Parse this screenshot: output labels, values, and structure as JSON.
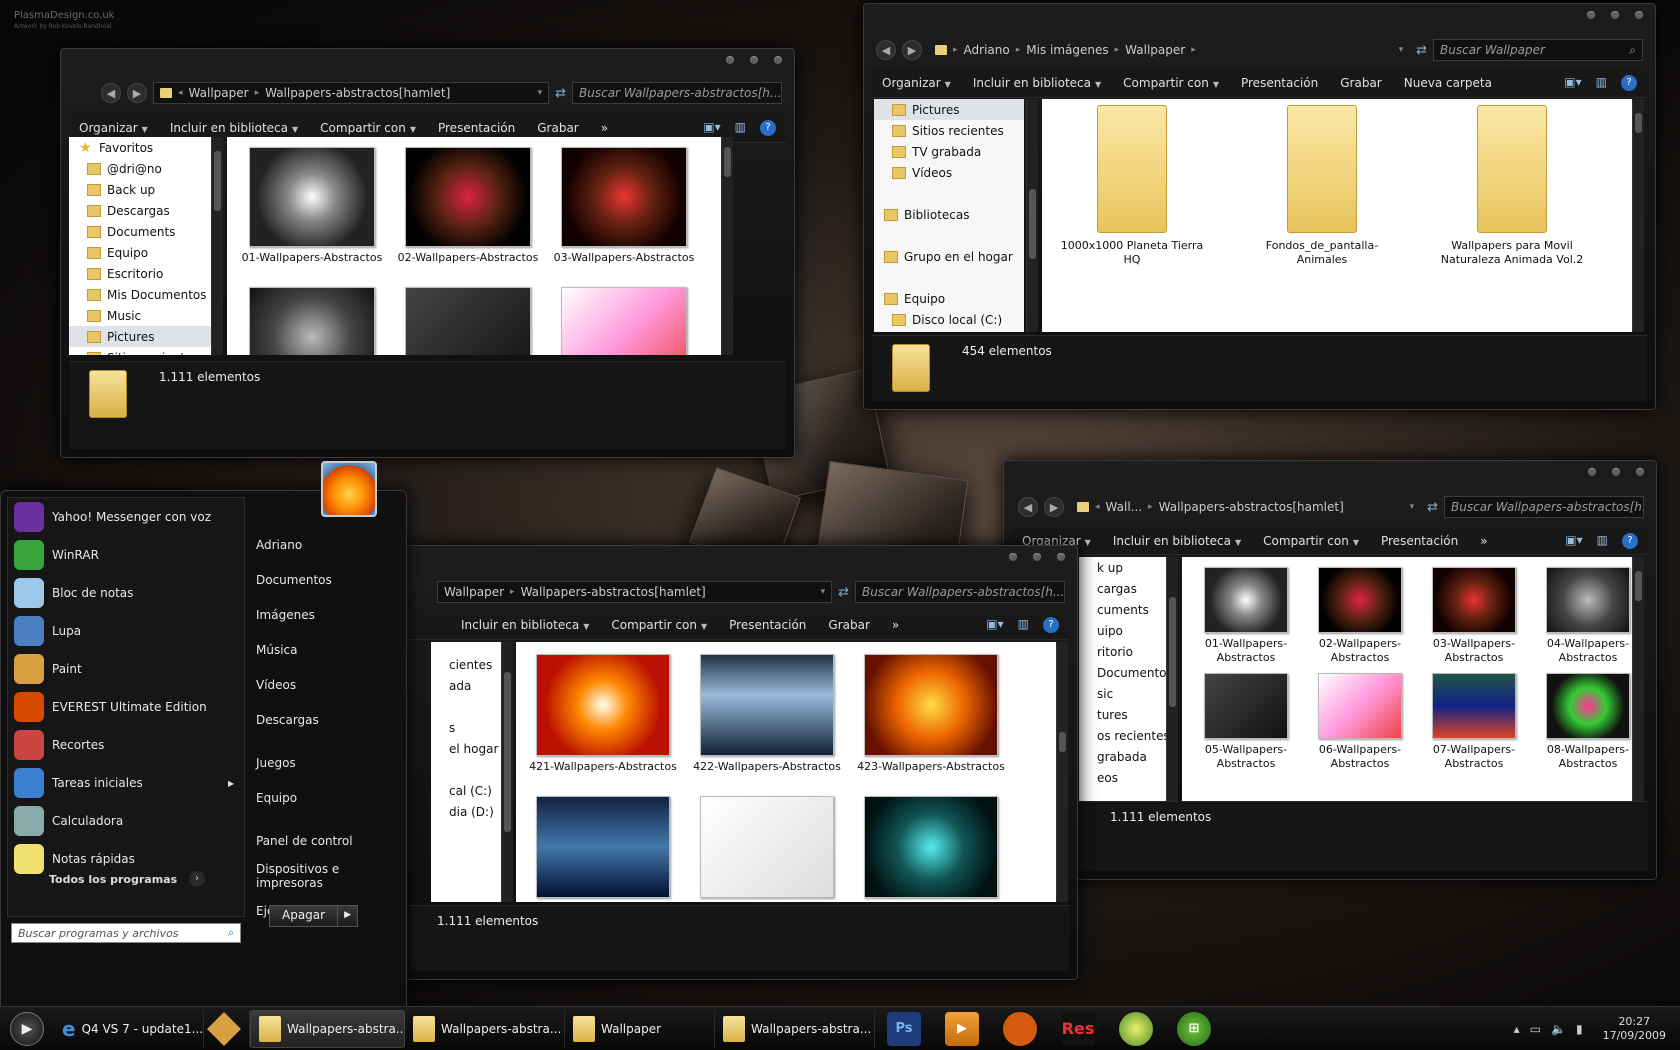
{
  "window1": {
    "path": [
      "Wallpaper",
      "Wallpapers-abstractos[hamlet]"
    ],
    "search": "Buscar Wallpapers-abstractos[h...",
    "toolbar": [
      "Organizar",
      "Incluir en biblioteca",
      "Compartir con",
      "Presentación",
      "Grabar",
      "»"
    ],
    "nav": [
      {
        "label": "Favoritos",
        "icon": "star-icon",
        "hd": true
      },
      {
        "label": "@dri@no"
      },
      {
        "label": "Back up"
      },
      {
        "label": "Descargas"
      },
      {
        "label": "Documents"
      },
      {
        "label": "Equipo"
      },
      {
        "label": "Escritorio"
      },
      {
        "label": "Mis Documentos"
      },
      {
        "label": "Music"
      },
      {
        "label": "Pictures",
        "sel": true
      },
      {
        "label": "Sitios recientes"
      }
    ],
    "items": [
      "01-Wallpapers-Abstractos",
      "02-Wallpapers-Abstractos",
      "03-Wallpapers-Abstractos",
      "",
      "",
      ""
    ],
    "status": "1.111 elementos"
  },
  "window2": {
    "path": [
      "Adriano",
      "Mis imágenes",
      "Wallpaper"
    ],
    "search": "Buscar Wallpaper",
    "toolbar": [
      "Organizar",
      "Incluir en biblioteca",
      "Compartir con",
      "Presentación",
      "Grabar",
      "Nueva carpeta"
    ],
    "nav": [
      {
        "label": "Pictures",
        "sel": true
      },
      {
        "label": "Sitios recientes"
      },
      {
        "label": "TV grabada"
      },
      {
        "label": "Vídeos"
      },
      {
        "label": ""
      },
      {
        "label": "Bibliotecas",
        "hd": true
      },
      {
        "label": ""
      },
      {
        "label": "Grupo en el hogar",
        "hd": true
      },
      {
        "label": ""
      },
      {
        "label": "Equipo",
        "hd": true
      },
      {
        "label": "Disco local (C:)"
      }
    ],
    "items": [
      "1000x1000 Planeta Tierra HQ",
      "Fondos_de_pantalla-Animales",
      "Wallpapers para Movil Naturaleza Animada Vol.2"
    ],
    "status": "454 elementos"
  },
  "window3": {
    "path": [
      "Wallpaper",
      "Wallpapers-abstractos[hamlet]"
    ],
    "search": "Buscar Wallpapers-abstractos[h...",
    "toolbar": [
      "Incluir en biblioteca",
      "Compartir con",
      "Presentación",
      "Grabar",
      "»"
    ],
    "nav": [
      "cientes",
      "ada",
      "",
      "s",
      "el hogar",
      "",
      "cal (C:)",
      "dia (D:)"
    ],
    "items": [
      "421-Wallpapers-Abstractos",
      "422-Wallpapers-Abstractos",
      "423-Wallpapers-Abstractos",
      "",
      "",
      ""
    ],
    "status": "1.111 elementos"
  },
  "window4": {
    "path": [
      "Wall...",
      "Wallpapers-abstractos[hamlet]"
    ],
    "search": "Buscar Wallpapers-abstractos[h...",
    "toolbar": [
      "Organizar",
      "Incluir en biblioteca",
      "Compartir con",
      "Presentación",
      "»"
    ],
    "nav": [
      "k up",
      "cargas",
      "cuments",
      "uipo",
      "ritorio",
      "Documentos",
      "sic",
      "tures",
      "os recientes",
      "grabada",
      "eos"
    ],
    "items": [
      "01-Wallpapers-Abstractos",
      "02-Wallpapers-Abstractos",
      "03-Wallpapers-Abstractos",
      "04-Wallpapers-Abstractos",
      "05-Wallpapers-Abstractos",
      "06-Wallpapers-Abstractos",
      "07-Wallpapers-Abstractos",
      "08-Wallpapers-Abstractos"
    ],
    "status": "1.111 elementos"
  },
  "start": {
    "programs": [
      {
        "label": "Yahoo! Messenger con voz",
        "color": "#6a2fa0"
      },
      {
        "label": "WinRAR",
        "color": "#3aa53a"
      },
      {
        "label": "Bloc de notas",
        "color": "#9cc7e8"
      },
      {
        "label": "Lupa",
        "color": "#4a7fc1"
      },
      {
        "label": "Paint",
        "color": "#d8a040"
      },
      {
        "label": "EVEREST Ultimate Edition",
        "color": "#d64a00"
      },
      {
        "label": "Recortes",
        "color": "#c44"
      },
      {
        "label": "Tareas iniciales",
        "color": "#3a7fd0"
      },
      {
        "label": "Calculadora",
        "color": "#8aa"
      },
      {
        "label": "Notas rápidas",
        "color": "#f0e070"
      }
    ],
    "all_programs": "Todos los programas",
    "search_placeholder": "Buscar programas y archivos",
    "right": [
      "Adriano",
      "Documentos",
      "Imágenes",
      "Música",
      "Vídeos",
      "Descargas",
      "Juegos",
      "Equipo",
      "Panel de control",
      "Dispositivos e impresoras",
      "Ejecutar..."
    ],
    "shutdown": "Apagar"
  },
  "taskbar": {
    "buttons": [
      "Q4 VS 7 - update1...",
      "",
      "Wallpapers-abstra...",
      "Wallpapers-abstra...",
      "Wallpaper",
      "Wallpapers-abstra..."
    ],
    "pins": [
      "Ps",
      "",
      "",
      "Res",
      "",
      ""
    ],
    "time": "20:27",
    "date": "17/09/2009"
  },
  "logo": {
    "line1": "PlasmaDesign.co.uk",
    "line2": "Artwork by Rob Kovels-Randhoel"
  }
}
